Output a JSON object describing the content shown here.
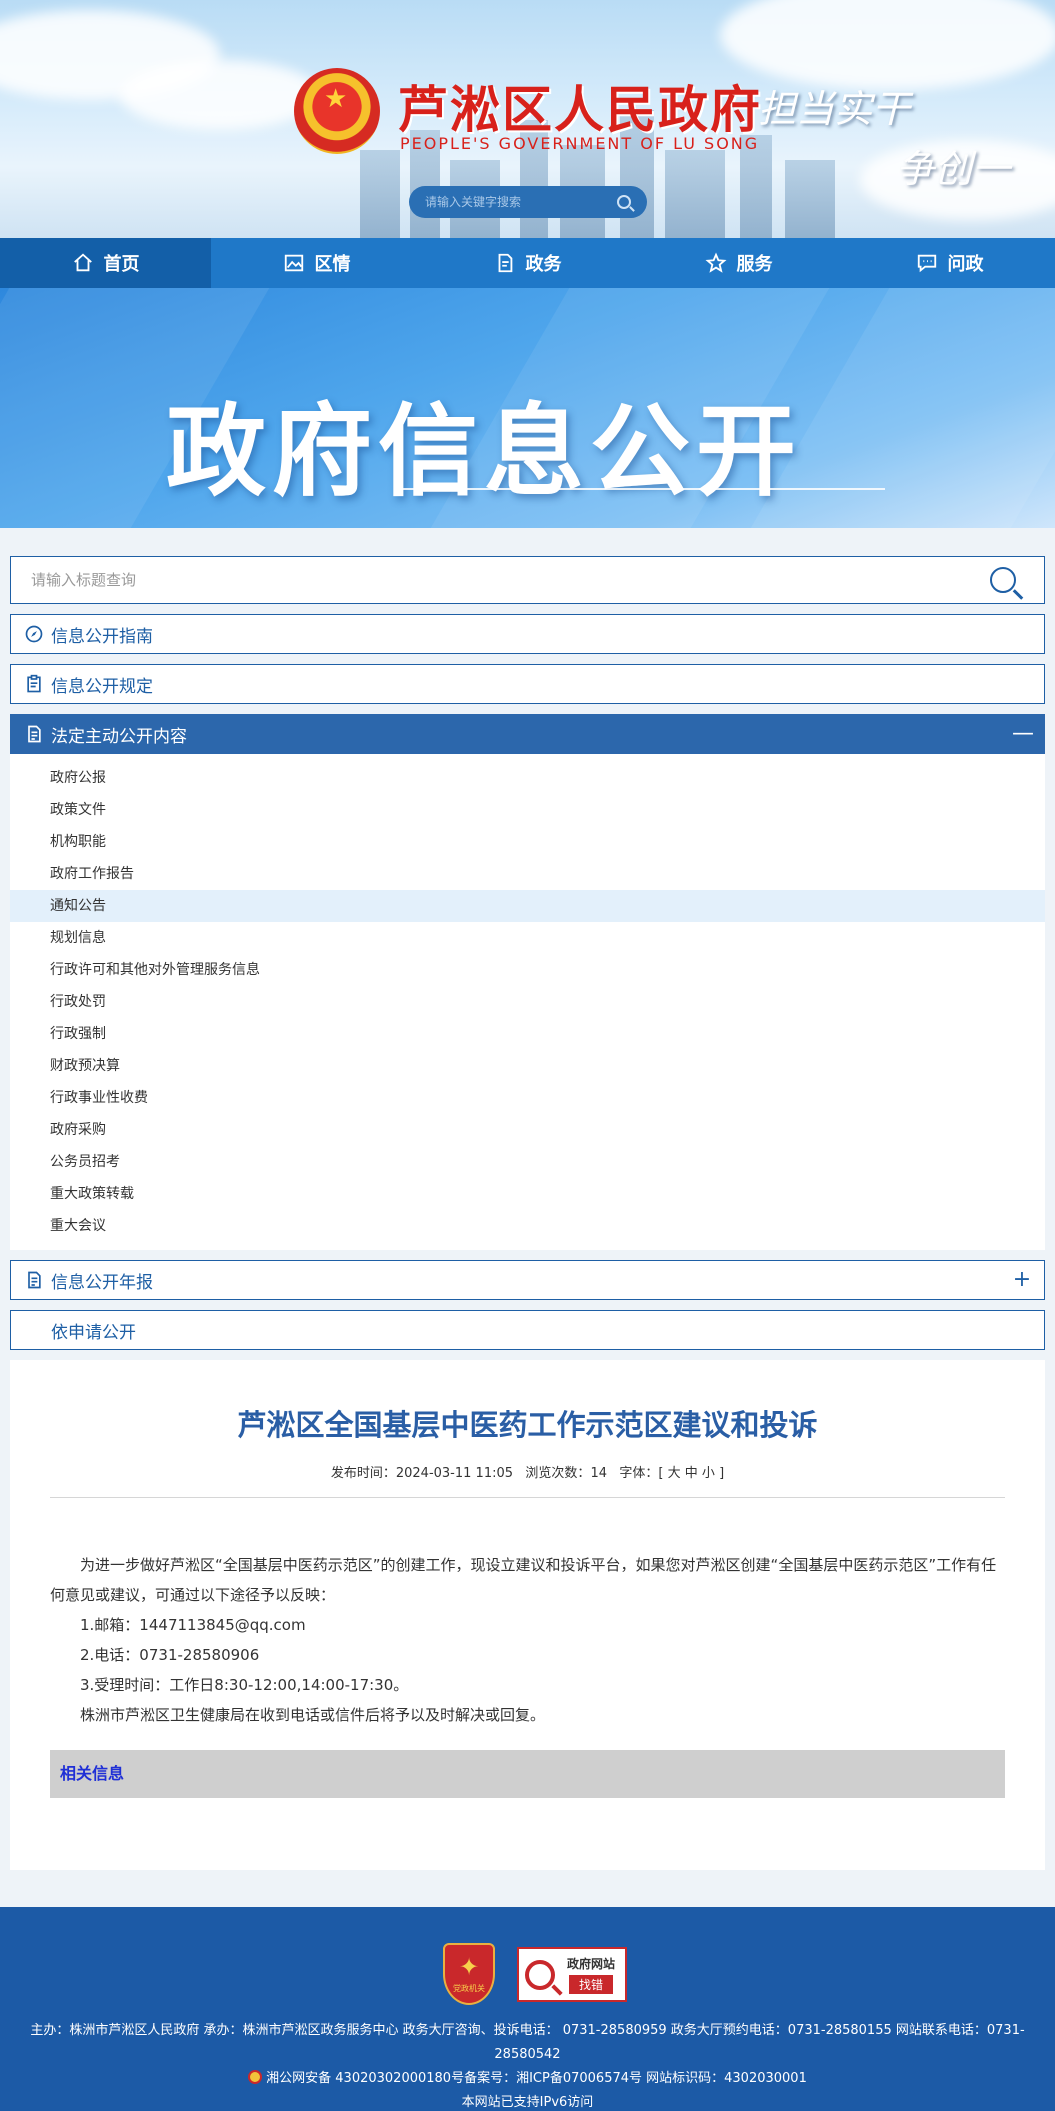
{
  "header": {
    "site_title": "芦淞区人民政府",
    "site_subtitle": "PEOPLE'S GOVERNMENT OF  LU SONG",
    "slogan_left": "担当实干",
    "slogan_right": "争创一",
    "search_placeholder": "请输入关键字搜索"
  },
  "nav": {
    "items": [
      {
        "label": "首页",
        "icon": "home-icon"
      },
      {
        "label": "区情",
        "icon": "picture-icon"
      },
      {
        "label": "政务",
        "icon": "document-icon"
      },
      {
        "label": "服务",
        "icon": "star-icon"
      },
      {
        "label": "问政",
        "icon": "chat-icon"
      }
    ],
    "active": 0
  },
  "hero": {
    "title": "政府信息公开"
  },
  "main": {
    "search_placeholder": "请输入标题查询",
    "sections": [
      {
        "label": "信息公开指南",
        "icon": "compass-icon"
      },
      {
        "label": "信息公开规定",
        "icon": "clipboard-icon"
      },
      {
        "label": "法定主动公开内容",
        "icon": "doc-list-icon",
        "toggle": "—"
      }
    ],
    "sub_items": [
      "政府公报",
      "政策文件",
      "机构职能",
      "政府工作报告",
      "通知公告",
      "规划信息",
      "行政许可和其他对外管理服务信息",
      "行政处罚",
      "行政强制",
      "财政预决算",
      "行政事业性收费",
      "政府采购",
      "公务员招考",
      "重大政策转载",
      "重大会议"
    ],
    "highlighted_sub": 4,
    "sections_after": [
      {
        "label": "信息公开年报",
        "icon": "doc-list-icon",
        "toggle": "+"
      },
      {
        "label": "依申请公开",
        "icon": ""
      }
    ]
  },
  "article": {
    "title": "芦淞区全国基层中医药工作示范区建议和投诉",
    "meta_publish_label": "发布时间：",
    "meta_publish_value": "2024-03-11 11:05",
    "meta_views_label": "浏览次数：",
    "meta_views_value": "14",
    "meta_font_label": "字体：[",
    "meta_font_large": "大",
    "meta_font_medium": "中",
    "meta_font_small": "小",
    "meta_font_close": "]",
    "paragraphs": [
      "为进一步做好芦淞区“全国基层中医药示范区”的创建工作，现设立建议和投诉平台，如果您对芦淞区创建“全国基层中医药示范区”工作有任何意见或建议，可通过以下途径予以反映：",
      "1.邮箱：1447113845@qq.com",
      "2.电话：0731-28580906",
      "3.受理时间：工作日8:30-12:00,14:00-17:30。",
      "株洲市芦淞区卫生健康局在收到电话或信件后将予以及时解决或回复。"
    ],
    "related_label": "相关信息"
  },
  "footer": {
    "badge1_text": "党政机关",
    "badge2_line1": "政府网站",
    "badge2_line2": "找错",
    "line1": "主办：株洲市芦淞区人民政府 承办：株洲市芦淞区政务服务中心 政务大厅咨询、投诉电话： 0731-28580959 政务大厅预约电话：0731-28580155 网站联系电话：0731-28580542",
    "line2": "湘公网安备 43020302000180号备案号：湘ICP备07006574号 网站标识码：4302030001",
    "line3": "本网站已支持IPv6访问"
  },
  "colors": {
    "nav_blue": "#1f78c8",
    "section_blue": "#1e5fa5",
    "article_title": "#2a5ea5",
    "footer_bg": "#1c5aa6"
  }
}
